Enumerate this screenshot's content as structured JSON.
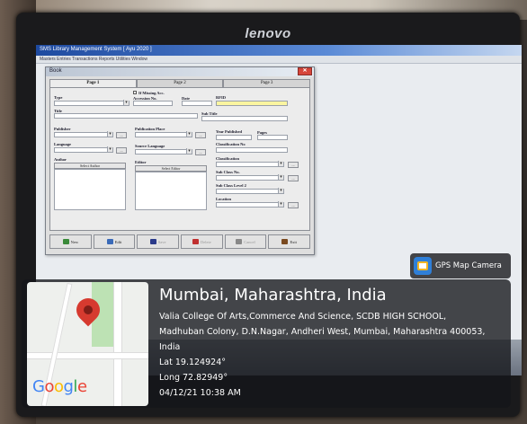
{
  "monitor": {
    "brand": "lenovo"
  },
  "app": {
    "title": "SMS Library Management System [ Ayu 2020 ]",
    "menu": "Masters  Entries  Transactions  Reports  Utilities  Window",
    "dialog_title": "Book"
  },
  "tabs": [
    "Page 1",
    "Page 2",
    "Page 3"
  ],
  "form": {
    "type": "Type",
    "missing": "If Missing Acc.",
    "accession": "Accession No.",
    "date": "Date",
    "rfid": "RFID",
    "title": "Title",
    "subtitle": "Sub Title",
    "publisher": "Publisher",
    "pub_place": "Publication Place",
    "year": "Year Published",
    "pages": "Pages",
    "language": "Language",
    "source_language": "Source Language",
    "class_no": "Classification No",
    "classification": "Classification",
    "author": "Author",
    "select_author": "Select Author",
    "editor": "Editor",
    "select_editor": "Select Editor",
    "sub_class": "Sub Class No.",
    "sub_class_2": "Sub Class Level 2",
    "location": "Location"
  },
  "toolbar": {
    "new": "New",
    "edit": "Edit",
    "save": "Save",
    "delete": "Delete",
    "cancel": "Cancel",
    "exit": "Exit"
  },
  "colors": {
    "new": "#3a8a3a",
    "edit": "#3a6ab8",
    "save": "#2a3a8a",
    "delete": "#c03030",
    "cancel": "#888888",
    "exit": "#7a4a20"
  },
  "gps": {
    "app_name": "GPS Map Camera",
    "city": "Mumbai, Maharashtra, India",
    "address1": "Valia College Of Arts,Commerce And Science, SCDB HIGH SCHOOL,",
    "address2": "Madhuban Colony, D.N.Nagar, Andheri West, Mumbai, Maharashtra 400053,",
    "address3": "India",
    "lat": "Lat 19.124924°",
    "long": "Long 72.82949°",
    "datetime": "04/12/21 10:38 AM",
    "map_brand": "Google"
  }
}
